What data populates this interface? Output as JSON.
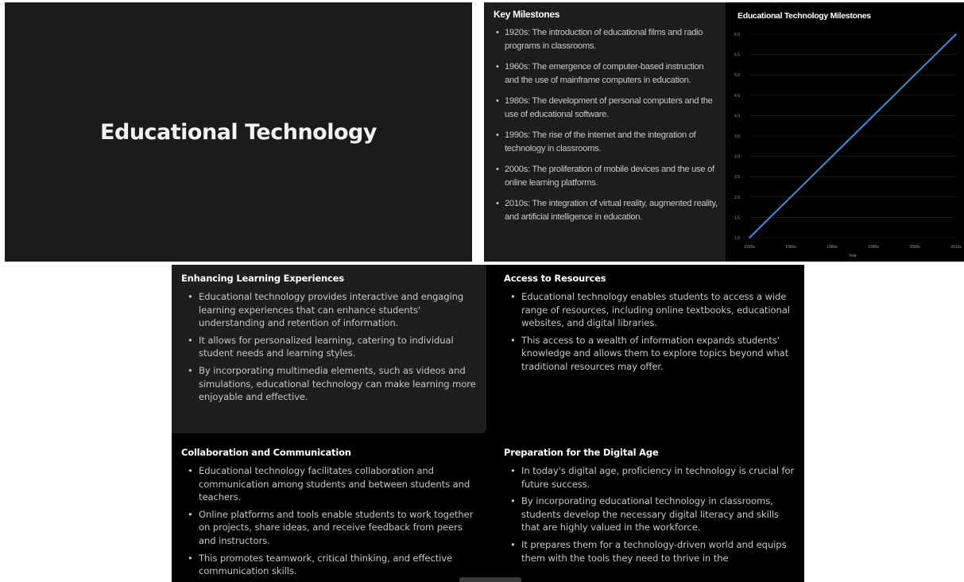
{
  "slide1": {
    "title": "Educational Technology"
  },
  "slide2": {
    "heading": "Key Milestones",
    "milestones": [
      "1920s: The introduction of educational films and radio programs in classrooms.",
      "1960s: The emergence of computer-based instruction and the use of mainframe computers in education.",
      "1980s: The development of personal computers and the use of educational software.",
      "1990s: The rise of the internet and the integration of technology in classrooms.",
      "2000s: The proliferation of mobile devices and the use of online learning platforms.",
      "2010s: The integration of virtual reality, augmented reality, and artificial intelligence in education."
    ]
  },
  "chart_data": {
    "type": "line",
    "title": "Educational Technology Milestones",
    "xlabel": "Year",
    "ylabel": "",
    "categories": [
      "1920s",
      "1960s",
      "1980s",
      "1990s",
      "2000s",
      "2010s"
    ],
    "series": [
      {
        "values": [
          1.0,
          2.0,
          3.0,
          4.0,
          5.0,
          6.0
        ],
        "color": "#3b8fd9"
      }
    ],
    "ylim": [
      1.0,
      6.0
    ],
    "yticks": [
      "1.0",
      "1.5",
      "2.0",
      "2.5",
      "3.0",
      "3.5",
      "4.0",
      "4.5",
      "5.0",
      "5.5",
      "6.0"
    ],
    "grid": true,
    "legend": "none"
  },
  "slide3": {
    "enhancing": {
      "heading": "Enhancing Learning Experiences",
      "items": [
        "Educational technology provides interactive and engaging learning experiences that can enhance students' understanding and retention of information.",
        "It allows for personalized learning, catering to individual student needs and learning styles.",
        "By incorporating multimedia elements, such as videos and simulations, educational technology can make learning more enjoyable and effective."
      ]
    },
    "access": {
      "heading": "Access to Resources",
      "items": [
        "Educational technology enables students to access a wide range of resources, including online textbooks, educational websites, and digital libraries.",
        "This access to a wealth of information expands students' knowledge and allows them to explore topics beyond what traditional resources may offer."
      ]
    },
    "collaboration": {
      "heading": "Collaboration and Communication",
      "items": [
        "Educational technology facilitates collaboration and communication among students and between students and teachers.",
        "Online platforms and tools enable students to work together on projects, share ideas, and receive feedback from peers and instructors.",
        "This promotes teamwork, critical thinking, and effective communication skills."
      ]
    },
    "preparation": {
      "heading": "Preparation for the Digital Age",
      "items": [
        "In today's digital age, proficiency in technology is crucial for future success.",
        "By incorporating educational technology in classrooms, students develop the necessary digital literacy and skills that are highly valued in the workforce.",
        "It prepares them for a technology-driven world and equips them with the tools they need to thrive in the"
      ]
    }
  }
}
